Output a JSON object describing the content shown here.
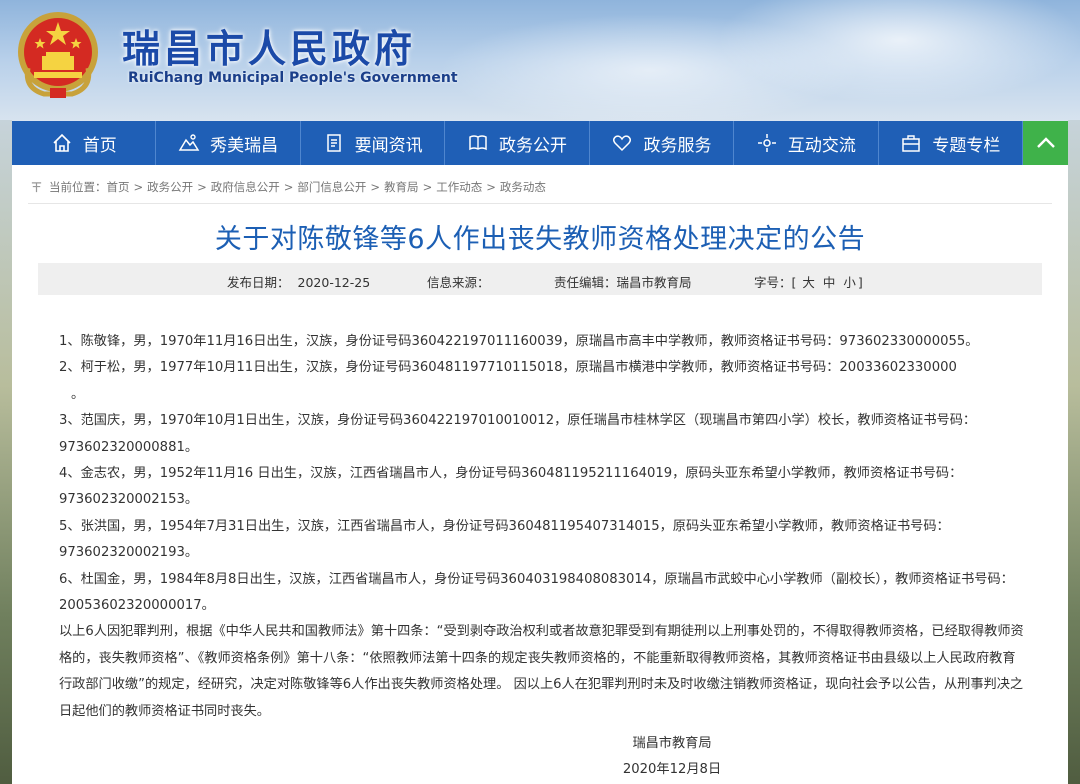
{
  "header": {
    "title": "瑞昌市人民政府",
    "subtitle": "RuiChang Municipal People's Government",
    "emblem_icon": "national-emblem"
  },
  "nav": {
    "items": [
      {
        "label": "首页",
        "icon": "home-icon"
      },
      {
        "label": "秀美瑞昌",
        "icon": "scenery-icon"
      },
      {
        "label": "要闻资讯",
        "icon": "document-icon"
      },
      {
        "label": "政务公开",
        "icon": "book-icon"
      },
      {
        "label": "政务服务",
        "icon": "heart-icon"
      },
      {
        "label": "互动交流",
        "icon": "interaction-icon"
      },
      {
        "label": "专题专栏",
        "icon": "briefcase-icon"
      }
    ],
    "toggle_icon": "chevron-up-icon",
    "color": "#1f5fb6",
    "toggle_color": "#3fb24a"
  },
  "breadcrumb": {
    "prefix": "当前位置：",
    "items": [
      "首页",
      "政务公开",
      "政府信息公开",
      "部门信息公开",
      "教育局",
      "工作动态",
      "政务动态"
    ],
    "separator": ">"
  },
  "article": {
    "title": "关于对陈敬锋等6人作出丧失教师资格处理决定的公告",
    "title_color": "#1c5fb4",
    "meta": {
      "date_label": "发布日期：",
      "date": "2020-12-25",
      "source_label": "信息来源：",
      "source": "",
      "editor_label": "责任编辑：",
      "editor": "瑞昌市教育局",
      "fontsize_label": "字号：",
      "fontsize_open": "[",
      "fontsize_large": "大",
      "fontsize_medium": "中",
      "fontsize_small": "小",
      "fontsize_close": "]"
    },
    "paragraphs": [
      "1、陈敬锋，男，1970年11月16日出生，汉族，身份证号码360422197011160039，原瑞昌市高丰中学教师，教师资格证书号码：973602330000055。",
      "2、柯于松，男，1977年10月11日出生，汉族，身份证号码360481197710115018，原瑞昌市横港中学教师，教师资格证书号码：20033602330000",
      "。",
      "3、范国庆，男，1970年10月1日出生，汉族，身份证号码360422197010010012，原任瑞昌市桂林学区（现瑞昌市第四小学）校长，教师资格证书号码：973602320000881。",
      "4、金志农，男，1952年11月16 日出生，汉族，江西省瑞昌市人，身份证号码360481195211164019，原码头亚东希望小学教师，教师资格证书号码：973602320002153。",
      "5、张洪国，男，1954年7月31日出生，汉族，江西省瑞昌市人，身份证号码360481195407314015，原码头亚东希望小学教师，教师资格证书号码：973602320002193。",
      "6、杜国金，男，1984年8月8日出生，汉族，江西省瑞昌市人，身份证号码360403198408083014，原瑞昌市武蛟中心小学教师（副校长），教师资格证书号码：20053602320000017。",
      "以上6人因犯罪判刑，根据《中华人民共和国教师法》第十四条：“受到剥夺政治权利或者故意犯罪受到有期徒刑以上刑事处罚的，不得取得教师资格，已经取得教师资格的，丧失教师资格”、《教师资格条例》第十八条：“依照教师法第十四条的规定丧失教师资格的，不能重新取得教师资格，其教师资格证书由县级以上人民政府教育行政部门收缴”的规定，经研究，决定对陈敬锋等6人作出丧失教师资格处理。 因以上6人在犯罪判刑时未及时收缴注销教师资格证，现向社会予以公告，从刑事判决之日起他们的教师资格证书同时丧失。"
    ],
    "signature": "瑞昌市教育局",
    "sign_date": "2020年12月8日"
  }
}
